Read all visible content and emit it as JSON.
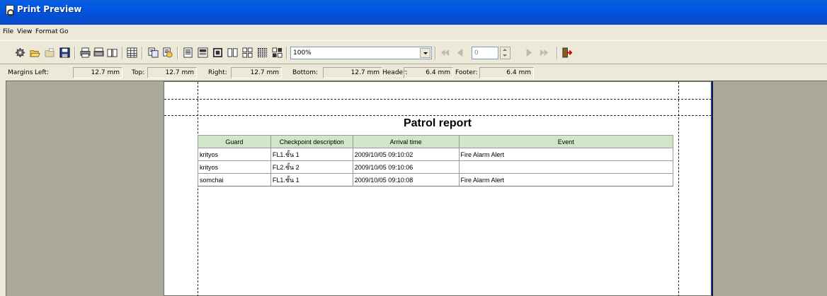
{
  "window": {
    "title": "Print Preview"
  },
  "menu": [
    "File",
    "View",
    "Format",
    "Go"
  ],
  "toolbar": {
    "zoom_value": "100%",
    "page_number": "0",
    "buttons": [
      "settings-icon",
      "open-icon",
      "open-folder-icon",
      "save-icon",
      "print-icon",
      "print-setup-icon",
      "book-icon",
      "grid-icon",
      "copy-icon",
      "printer-icon",
      "one-page-icon",
      "two-pages-icon",
      "four-pages-icon",
      "six-pages-icon",
      "eight-pages-icon",
      "many-pages-icon",
      "many-pages-2-icon",
      "first-page-icon",
      "prev-page-icon",
      "next-page-icon",
      "last-page-icon",
      "exit-icon"
    ]
  },
  "margins": {
    "label": "Margins",
    "left_label": "Left:",
    "left_value": "12.7 mm",
    "top_label": "Top:",
    "top_value": "12.7 mm",
    "right_label": "Right:",
    "right_value": "12.7 mm",
    "bottom_label": "Bottom:",
    "bottom_value": "12.7 mm",
    "header_label": "Header:",
    "header_value": "6.4 mm",
    "footer_label": "Footer:",
    "footer_value": "6.4 mm"
  },
  "report": {
    "title": "Patrol report",
    "columns": [
      "Guard",
      "Checkpoint description",
      "Arrival time",
      "Event"
    ],
    "rows": [
      [
        "krityos",
        "FL1.ชั้น 1",
        "2009/10/05 09:10:02",
        "Fire Alarm Alert"
      ],
      [
        "krityos",
        "FL2.ชั้น 2",
        "2009/10/05 09:10:06",
        ""
      ],
      [
        "somchai",
        "FL1.ชั้น 1",
        "2009/10/05 09:10:08",
        "Fire Alarm Alert"
      ]
    ]
  }
}
